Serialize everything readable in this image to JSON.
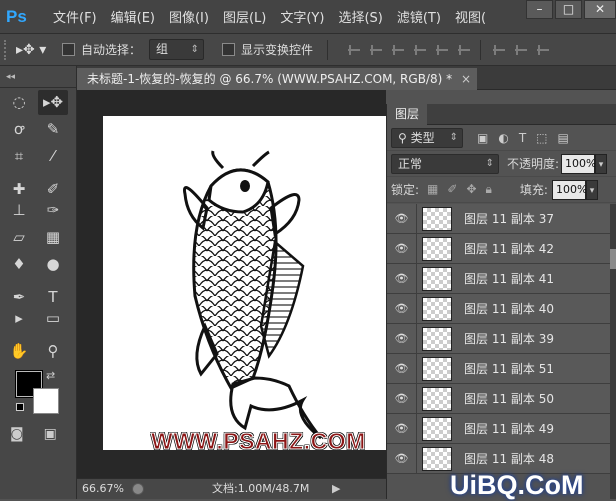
{
  "app": {
    "logo": "Ps"
  },
  "menu": [
    "文件(F)",
    "编辑(E)",
    "图像(I)",
    "图层(L)",
    "文字(Y)",
    "选择(S)",
    "滤镜(T)",
    "视图("
  ],
  "window_controls": [
    "–",
    "□",
    "✕"
  ],
  "options": {
    "tool_icon": "move-icon",
    "auto_select_label": "自动选择：",
    "auto_select_value": "组",
    "show_transform_label": "显示变换控件"
  },
  "document": {
    "tab_title": "未标题-1-恢复的-恢复的 @ 66.7% (WWW.PSAHZ.COM, RGB/8) *",
    "close": "×",
    "watermark": "WWW.PSAHZ.COM"
  },
  "status": {
    "zoom": "66.67%",
    "doc_info": "文档:1.00M/48.7M",
    "arrow": "▶"
  },
  "toolbar": {
    "grip": "◂◂"
  },
  "layers_panel": {
    "tab": "图层",
    "filter_kind": "类型",
    "blend_mode": "正常",
    "opacity_label": "不透明度:",
    "opacity_value": "100%",
    "lock_label": "锁定:",
    "fill_label": "填充:",
    "fill_value": "100%",
    "layers": [
      {
        "name": "图层 11 副本 37"
      },
      {
        "name": "图层 11 副本 42"
      },
      {
        "name": "图层 11 副本 41"
      },
      {
        "name": "图层 11 副本 40"
      },
      {
        "name": "图层 11 副本 39"
      },
      {
        "name": "图层 11 副本 51"
      },
      {
        "name": "图层 11 副本 50"
      },
      {
        "name": "图层 11 副本 49"
      },
      {
        "name": "图层 11 副本 48"
      }
    ]
  },
  "brand": "UiBQ.CoM",
  "colors": {
    "foreground": "#000000",
    "background": "#ffffff"
  }
}
